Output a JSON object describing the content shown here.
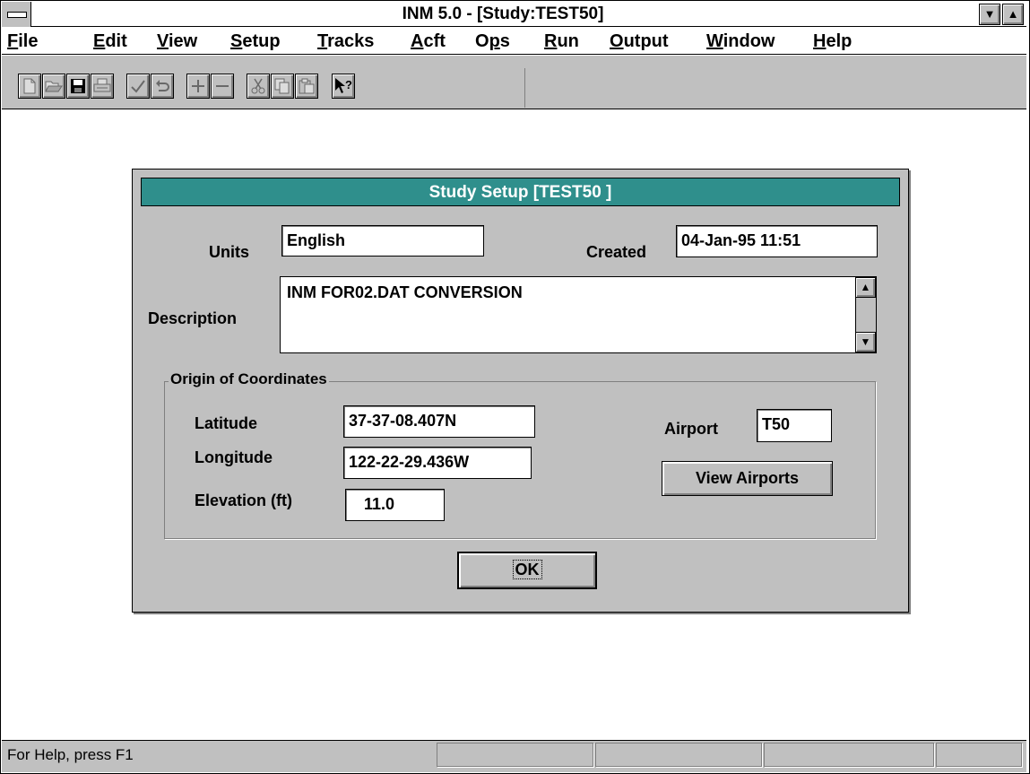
{
  "window": {
    "title": "INM 5.0 - [Study:TEST50]",
    "min_glyph": "▼",
    "max_glyph": "▲"
  },
  "menu": {
    "items": [
      {
        "first": "F",
        "rest": "ile"
      },
      {
        "first": "E",
        "rest": "dit"
      },
      {
        "first": "V",
        "rest": "iew"
      },
      {
        "first": "S",
        "rest": "etup"
      },
      {
        "first": "T",
        "rest": "racks"
      },
      {
        "first": "A",
        "rest": "cft"
      },
      {
        "first": "O",
        "rest": "ps",
        "underline_index": 1
      },
      {
        "first": "R",
        "rest": "un"
      },
      {
        "first": "O",
        "rest": "utput"
      },
      {
        "first": "W",
        "rest": "indow"
      },
      {
        "first": "H",
        "rest": "elp"
      }
    ]
  },
  "toolbar": {
    "icons": [
      "new-icon",
      "open-icon",
      "save-icon",
      "print-icon",
      "check-icon",
      "undo-icon",
      "add-icon",
      "remove-icon",
      "cut-icon",
      "copy-icon",
      "paste-icon",
      "context-help-icon"
    ]
  },
  "dialog": {
    "title": "Study Setup [TEST50 ]",
    "units_label": "Units",
    "units_value": "English",
    "created_label": "Created",
    "created_value": "04-Jan-95 11:51",
    "description_label": "Description",
    "description_value": "INM FOR02.DAT CONVERSION",
    "group_label": "Origin of Coordinates",
    "latitude_label": "Latitude",
    "latitude_value": "37-37-08.407N",
    "longitude_label": "Longitude",
    "longitude_value": "122-22-29.436W",
    "elevation_label": "Elevation (ft)",
    "elevation_value": "11.0",
    "airport_label": "Airport",
    "airport_value": "T50",
    "view_airports_label": "View Airports",
    "ok_label": "OK"
  },
  "statusbar": {
    "text": "For Help, press F1"
  },
  "colors": {
    "dialog_title_bg": "#2f8f8c",
    "face": "#c0c0c0"
  }
}
